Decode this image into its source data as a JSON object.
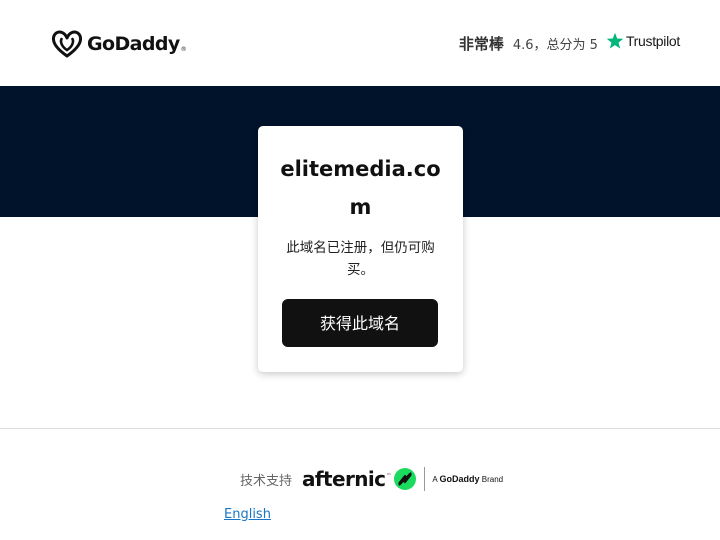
{
  "header": {
    "logo": {
      "text": "GoDaddy",
      "trademark": "®",
      "icon": "godaddy-heart-logo-icon"
    },
    "rating": {
      "word": "非常棒",
      "detail": "4.6，总分为 5",
      "brand": "Trustpilot",
      "star_icon": "trustpilot-star-icon",
      "star_color": "#00b67a"
    }
  },
  "hero": {
    "band_color": "#00132b"
  },
  "card": {
    "domain": "elitemedia.com",
    "status": "此域名已注册，但仍可购买。",
    "button_label": "获得此域名",
    "button_color": "#111111"
  },
  "footer": {
    "powered_label": "技术支持",
    "partner": {
      "name": "afternic",
      "trademark": "™",
      "icon": "afternic-arrows-logo-icon",
      "icon_color": "#1bdb5e",
      "tagline_prefix": "A",
      "tagline_brand": "GoDaddy",
      "tagline_suffix": "Brand"
    },
    "language_link": "English",
    "link_color": "#1976c4"
  }
}
